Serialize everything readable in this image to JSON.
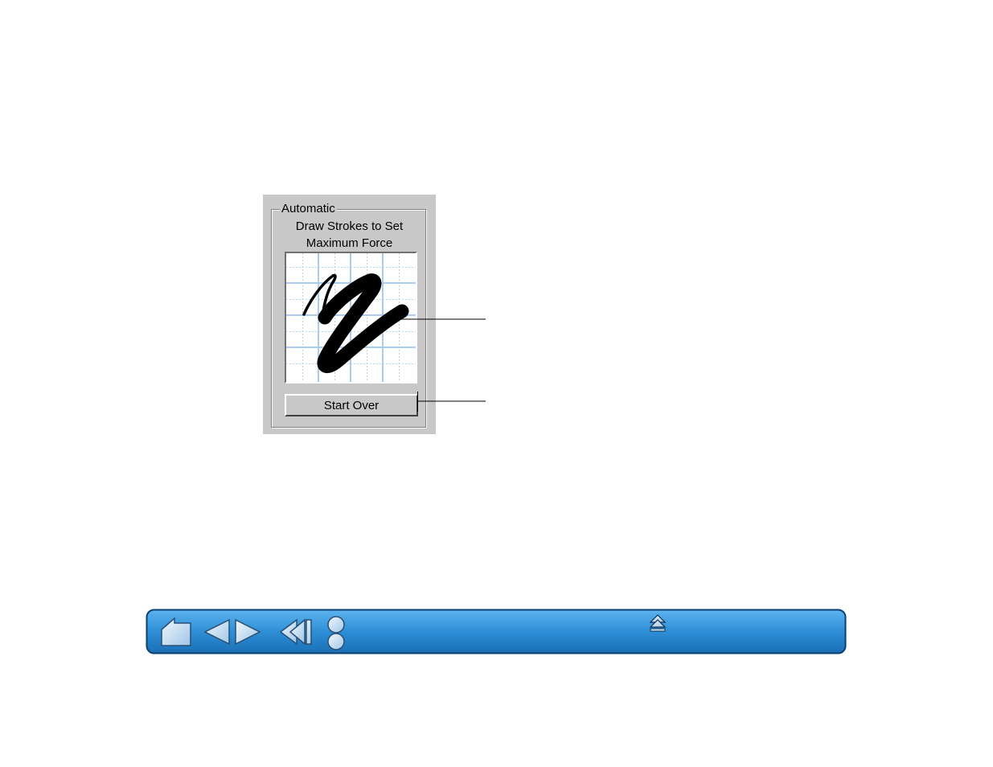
{
  "dialog": {
    "group_title": "Automatic",
    "instruction_line1": "Draw Strokes to Set",
    "instruction_line2": "Maximum Force",
    "start_over_label": "Start Over"
  },
  "navbar": {
    "buttons": [
      {
        "name": "home-icon"
      },
      {
        "name": "previous-page-icon"
      },
      {
        "name": "next-page-icon"
      },
      {
        "name": "back-icon"
      },
      {
        "name": "contents-index-icon"
      },
      {
        "name": "top-of-section-icon"
      }
    ]
  },
  "colors": {
    "panel_bg": "#c8c8c8",
    "grid_major": "#a8cdef",
    "grid_minor": "#b4d4f0",
    "navbar_fill": "#2e8fd6",
    "navbar_border": "#0c3f72",
    "nav_icon_fill": "#cfe4f4"
  }
}
